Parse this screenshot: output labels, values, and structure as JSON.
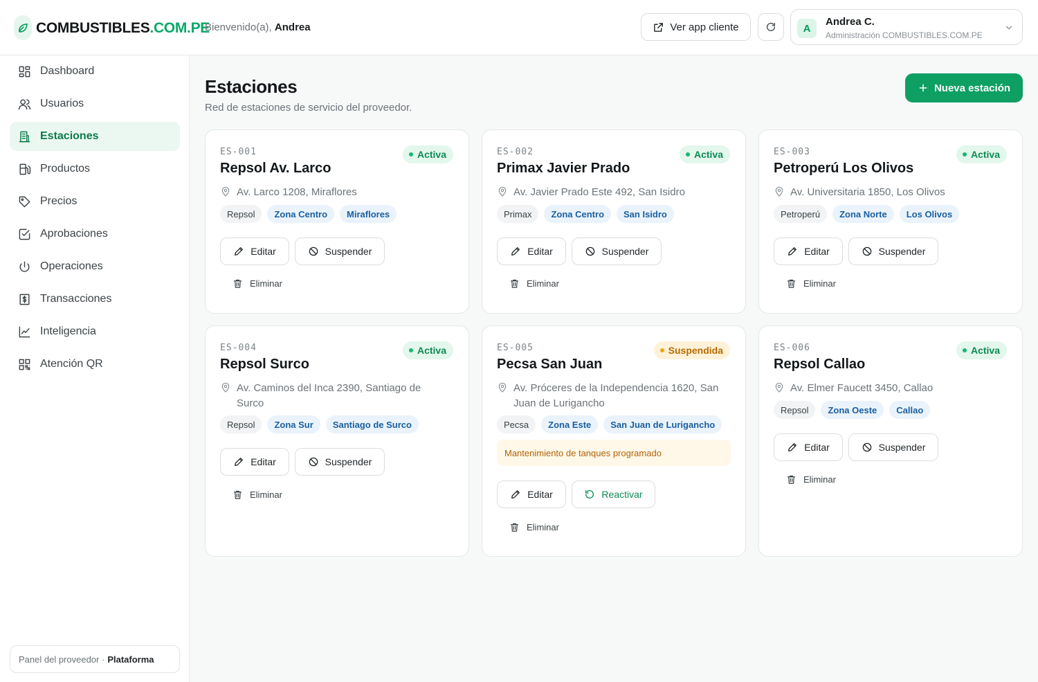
{
  "brand": {
    "name": "COMBUSTIBLES",
    "domain": ".COM.PE",
    "accent": "#0e9f63"
  },
  "header": {
    "welcome_prefix": "Bienvenido(a),",
    "welcome_user": "Andrea",
    "view_app_label": "Ver app cliente",
    "user_name": "Andrea C.",
    "user_role": "Administración COMBUSTIBLES.COM.PE",
    "avatar_initial": "A"
  },
  "sidebar": {
    "items": [
      {
        "label": "Dashboard",
        "icon": "grid-icon"
      },
      {
        "label": "Usuarios",
        "icon": "users-icon"
      },
      {
        "label": "Estaciones",
        "icon": "building-icon",
        "active": true
      },
      {
        "label": "Productos",
        "icon": "fuel-pump-icon"
      },
      {
        "label": "Precios",
        "icon": "tag-icon"
      },
      {
        "label": "Aprobaciones",
        "icon": "check-square-icon"
      },
      {
        "label": "Operaciones",
        "icon": "power-icon"
      },
      {
        "label": "Transacciones",
        "icon": "dollar-receipt-icon"
      },
      {
        "label": "Inteligencia",
        "icon": "line-chart-icon"
      },
      {
        "label": "Atención QR",
        "icon": "qr-icon"
      }
    ],
    "footer_prefix": "Panel del proveedor ·",
    "footer_strong": "Plataforma"
  },
  "main": {
    "title": "Estaciones",
    "subtitle": "Red de estaciones de servicio del proveedor.",
    "new_button": "Nueva estación"
  },
  "labels": {
    "edit": "Editar",
    "suspend": "Suspender",
    "reactivate": "Reactivar",
    "delete": "Eliminar"
  },
  "stations": [
    {
      "code": "ES-001",
      "name": "Repsol Av. Larco",
      "status": "Activa",
      "address": "Av. Larco 1208, Miraflores",
      "tags": [
        "Repsol",
        "Zona Centro",
        "Miraflores"
      ]
    },
    {
      "code": "ES-002",
      "name": "Primax Javier Prado",
      "status": "Activa",
      "address": "Av. Javier Prado Este 492, San Isidro",
      "tags": [
        "Primax",
        "Zona Centro",
        "San Isidro"
      ]
    },
    {
      "code": "ES-003",
      "name": "Petroperú Los Olivos",
      "status": "Activa",
      "address": "Av. Universitaria 1850, Los Olivos",
      "tags": [
        "Petroperú",
        "Zona Norte",
        "Los Olivos"
      ]
    },
    {
      "code": "ES-004",
      "name": "Repsol Surco",
      "status": "Activa",
      "address": "Av. Caminos del Inca 2390, Santiago de Surco",
      "tags": [
        "Repsol",
        "Zona Sur",
        "Santiago de Surco"
      ]
    },
    {
      "code": "ES-005",
      "name": "Pecsa San Juan",
      "status": "Suspendida",
      "address": "Av. Próceres de la Independencia 1620, San Juan de Lurigancho",
      "tags": [
        "Pecsa",
        "Zona Este",
        "San Juan de Lurigancho"
      ],
      "note": "Mantenimiento de tanques programado"
    },
    {
      "code": "ES-006",
      "name": "Repsol Callao",
      "status": "Activa",
      "address": "Av. Elmer Faucett 3450, Callao",
      "tags": [
        "Repsol",
        "Zona Oeste",
        "Callao"
      ]
    }
  ]
}
